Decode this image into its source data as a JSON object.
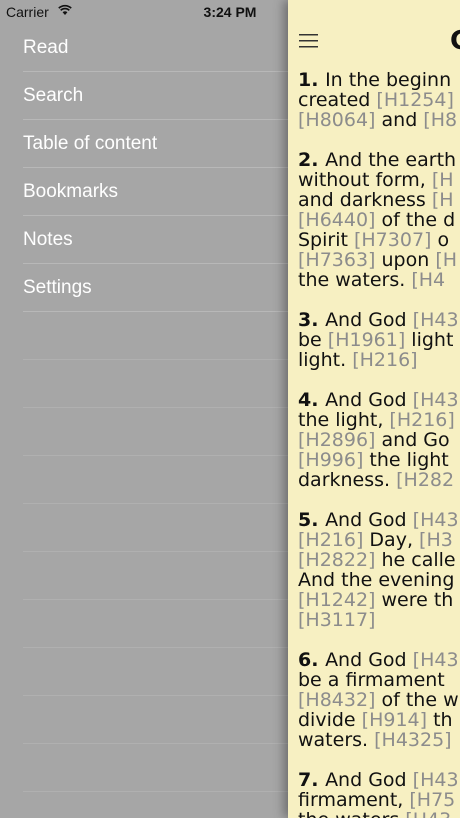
{
  "status_bar": {
    "carrier": "Carrier",
    "time": "3:24 PM"
  },
  "menu": {
    "items": [
      {
        "label": "Read"
      },
      {
        "label": "Search"
      },
      {
        "label": "Table of content"
      },
      {
        "label": "Bookmarks"
      },
      {
        "label": "Notes"
      },
      {
        "label": "Settings"
      }
    ]
  },
  "reader": {
    "title_partial": "G",
    "verses": [
      {
        "number": "1.",
        "lines": [
          [
            {
              "t": "In the beginn"
            }
          ],
          [
            {
              "t": "created "
            },
            {
              "r": "[H1254]"
            }
          ],
          [
            {
              "r": "[H8064]"
            },
            {
              "t": " and "
            },
            {
              "r": "[H8"
            }
          ]
        ]
      },
      {
        "number": "2.",
        "lines": [
          [
            {
              "t": "And the earth"
            }
          ],
          [
            {
              "t": "without form, "
            },
            {
              "r": "[H"
            }
          ],
          [
            {
              "t": "and darkness "
            },
            {
              "r": "[H"
            }
          ],
          [
            {
              "r": "[H6440]"
            },
            {
              "t": " of the d"
            }
          ],
          [
            {
              "t": "Spirit "
            },
            {
              "r": "[H7307]"
            },
            {
              "t": " o"
            }
          ],
          [
            {
              "r": "[H7363]"
            },
            {
              "t": " upon "
            },
            {
              "r": "[H"
            }
          ],
          [
            {
              "t": "the waters. "
            },
            {
              "r": "[H4"
            }
          ]
        ]
      },
      {
        "number": "3.",
        "lines": [
          [
            {
              "t": "And God "
            },
            {
              "r": "[H43"
            }
          ],
          [
            {
              "t": "be "
            },
            {
              "r": "[H1961]"
            },
            {
              "t": " light"
            }
          ],
          [
            {
              "t": "light. "
            },
            {
              "r": "[H216]"
            }
          ]
        ]
      },
      {
        "number": "4.",
        "lines": [
          [
            {
              "t": "And God "
            },
            {
              "r": "[H43"
            }
          ],
          [
            {
              "t": "the light, "
            },
            {
              "r": "[H216]"
            }
          ],
          [
            {
              "r": "[H2896]"
            },
            {
              "t": " and Go"
            }
          ],
          [
            {
              "r": "[H996]"
            },
            {
              "t": " the light"
            }
          ],
          [
            {
              "t": "darkness. "
            },
            {
              "r": "[H282"
            }
          ]
        ]
      },
      {
        "number": "5.",
        "lines": [
          [
            {
              "t": "And God "
            },
            {
              "r": "[H43"
            }
          ],
          [
            {
              "r": "[H216]"
            },
            {
              "t": " Day, "
            },
            {
              "r": "[H3"
            }
          ],
          [
            {
              "r": "[H2822]"
            },
            {
              "t": " he calle"
            }
          ],
          [
            {
              "t": "And the evening"
            }
          ],
          [
            {
              "r": "[H1242]"
            },
            {
              "t": " were th"
            }
          ],
          [
            {
              "r": "[H3117]"
            }
          ]
        ]
      },
      {
        "number": "6.",
        "lines": [
          [
            {
              "t": "And God "
            },
            {
              "r": "[H43"
            }
          ],
          [
            {
              "t": "be a firmament "
            }
          ],
          [
            {
              "r": "[H8432]"
            },
            {
              "t": " of the w"
            }
          ],
          [
            {
              "t": "divide "
            },
            {
              "r": "[H914]"
            },
            {
              "t": " th"
            }
          ],
          [
            {
              "t": "waters. "
            },
            {
              "r": "[H4325]"
            }
          ]
        ]
      },
      {
        "number": "7.",
        "lines": [
          [
            {
              "t": "And God "
            },
            {
              "r": "[H43"
            }
          ],
          [
            {
              "t": "firmament, "
            },
            {
              "r": "[H75"
            }
          ],
          [
            {
              "t": "the waters "
            },
            {
              "r": "[H43"
            }
          ]
        ]
      }
    ]
  }
}
